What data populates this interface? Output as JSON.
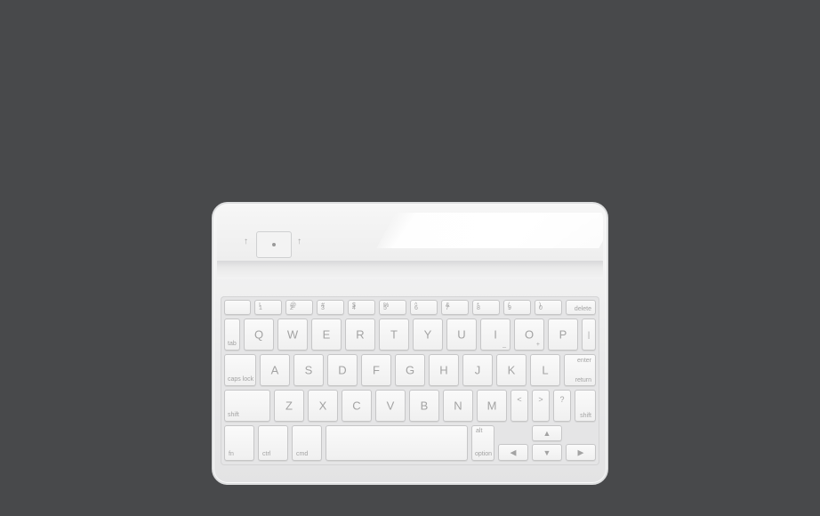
{
  "keyboard": {
    "row0": [
      {
        "top": "",
        "bottom": ""
      },
      {
        "top": "!",
        "bottom": "1"
      },
      {
        "top": "@",
        "bottom": "2"
      },
      {
        "top": "#",
        "bottom": "3"
      },
      {
        "top": "$",
        "bottom": "4"
      },
      {
        "top": "%",
        "bottom": "5"
      },
      {
        "top": "^",
        "bottom": "6"
      },
      {
        "top": "&",
        "bottom": "7"
      },
      {
        "top": "*",
        "bottom": "8"
      },
      {
        "top": "(",
        "bottom": "9"
      },
      {
        "top": ")",
        "bottom": "0"
      },
      {
        "top": "",
        "bottom": "delete"
      }
    ],
    "row1": [
      "Q",
      "W",
      "E",
      "R",
      "T",
      "Y",
      "U",
      "I",
      "O",
      "P"
    ],
    "row1_tab": "tab",
    "row1_extra": [
      "_",
      "+"
    ],
    "row1_pipe": "|",
    "row2": [
      "A",
      "S",
      "D",
      "F",
      "G",
      "H",
      "J",
      "K",
      "L"
    ],
    "row2_caps": "caps lock",
    "row2_enter_top": "enter",
    "row2_enter_bottom": "return",
    "row3": [
      "Z",
      "X",
      "C",
      "V",
      "B",
      "N",
      "M"
    ],
    "row3_shift_left": "shift",
    "row3_lt": "<",
    "row3_gt": ">",
    "row3_qm": "?",
    "row3_shift_right": "shift",
    "row4_fn": "fn",
    "row4_ctrl": "ctrl",
    "row4_cmd": "cmd",
    "row4_alt": "alt",
    "row4_option": "option",
    "arrows": {
      "up": "▲",
      "left": "◀",
      "down": "▼",
      "right": "▶"
    }
  }
}
